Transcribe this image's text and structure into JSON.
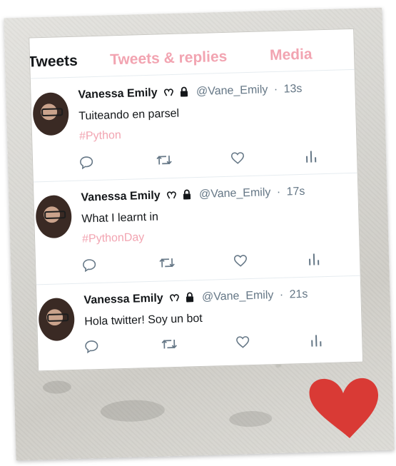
{
  "colors": {
    "accent": "#f2a4b1",
    "text": "#14171a",
    "muted": "#657786",
    "heart": "#d93a35"
  },
  "tabs": [
    {
      "label": "Tweets"
    },
    {
      "label": "Tweets & replies"
    },
    {
      "label": "Media"
    }
  ],
  "tweets": [
    {
      "name": "Vanessa Emily",
      "handle": "@Vane_Emily",
      "time": "13s",
      "text": "Tuiteando en parsel",
      "hashtag": "#Python"
    },
    {
      "name": "Vanessa Emily",
      "handle": "@Vane_Emily",
      "time": "17s",
      "text": "What I learnt in",
      "hashtag": "#PythonDay"
    },
    {
      "name": "Vanessa Emily",
      "handle": "@Vane_Emily",
      "time": "21s",
      "text": "Hola twitter! Soy un bot",
      "hashtag": ""
    }
  ],
  "icons": [
    "reply-icon",
    "retweet-icon",
    "like-icon",
    "analytics-icon",
    "heart-sticker"
  ]
}
